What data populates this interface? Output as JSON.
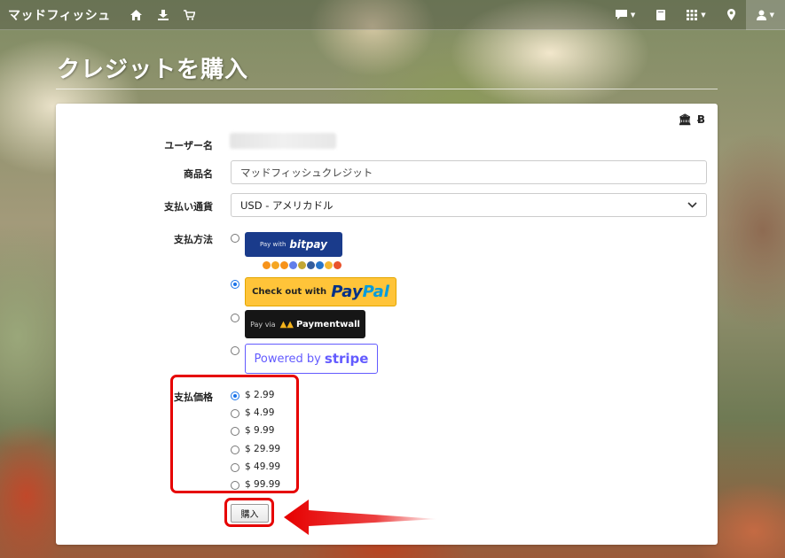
{
  "navbar": {
    "brand": "マッドフィッシュ",
    "left_icons": [
      "home-icon",
      "download-icon",
      "cart-icon"
    ],
    "right_icons": [
      "chat-icon",
      "book-icon",
      "grid-icon",
      "map-marker-icon",
      "user-icon"
    ]
  },
  "page": {
    "title": "クレジットを購入"
  },
  "card": {
    "corner_icons": [
      "bank-icon",
      "bitcoin-icon"
    ],
    "bitcoin_symbol": "Ƀ",
    "bank_symbol": "🏛",
    "form": {
      "username_label": "ユーザー名",
      "product_label": "商品名",
      "product_value": "マッドフィッシュクレジット",
      "currency_label": "支払い通貨",
      "currency_value": "USD - アメリカドル",
      "method_label": "支払方法",
      "payment_methods": [
        {
          "id": "bitpay",
          "prefix": "Pay with",
          "name": "bitpay",
          "selected": false
        },
        {
          "id": "paypal",
          "prefix": "Check out with",
          "name_part1": "Pay",
          "name_part2": "Pal",
          "selected": true
        },
        {
          "id": "paymentwall",
          "prefix": "Pay via",
          "name": "Paymentwall",
          "selected": false
        },
        {
          "id": "stripe",
          "prefix": "Powered by",
          "name": "stripe",
          "selected": false
        }
      ],
      "price_label": "支払価格",
      "prices": [
        {
          "label": "$ 2.99",
          "selected": true
        },
        {
          "label": "$ 4.99",
          "selected": false
        },
        {
          "label": "$ 9.99",
          "selected": false
        },
        {
          "label": "$ 29.99",
          "selected": false
        },
        {
          "label": "$ 49.99",
          "selected": false
        },
        {
          "label": "$ 99.99",
          "selected": false
        }
      ],
      "buy_button": "購入"
    }
  },
  "colors": {
    "highlight": "#e60000",
    "paypal_yellow": "#ffc439",
    "bitpay_blue": "#1a3b8b",
    "stripe_purple": "#635bff"
  }
}
